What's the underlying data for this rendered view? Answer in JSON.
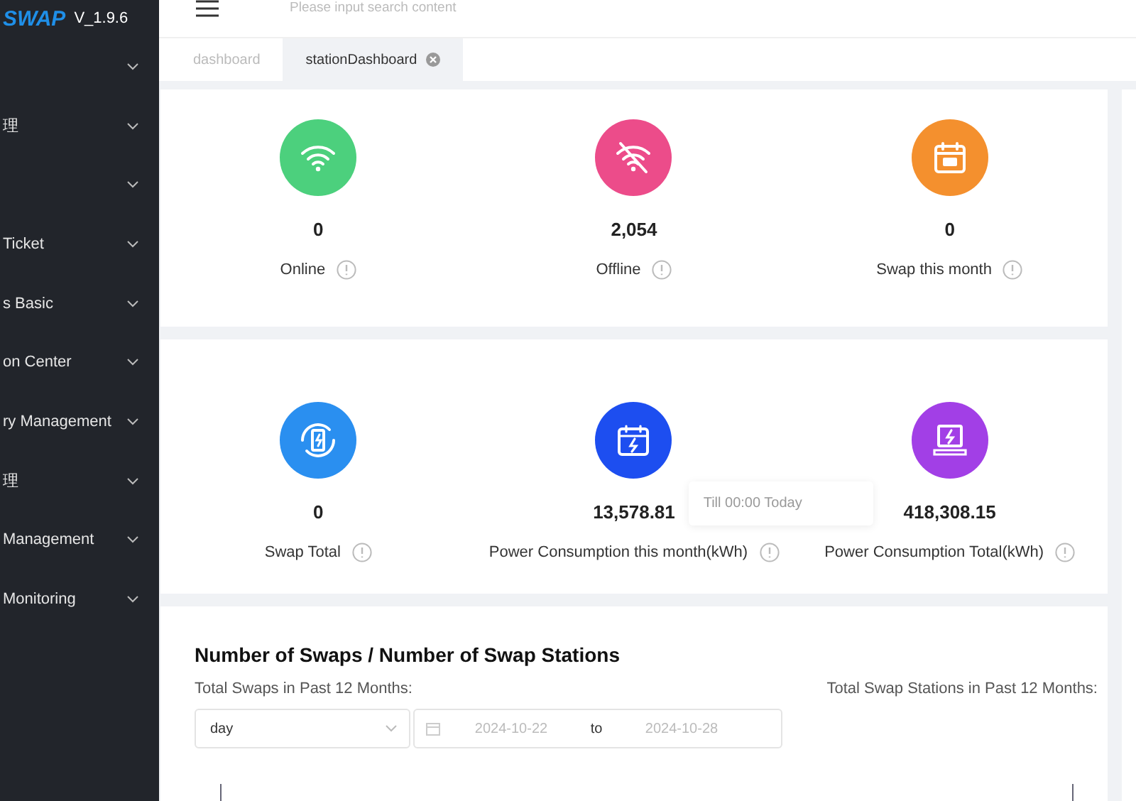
{
  "sidebar": {
    "logo": "SWAP",
    "version": "V_1.9.6",
    "items": [
      {
        "expanded": false
      },
      {
        "label": "理",
        "expanded": false
      },
      {
        "expanded": false
      },
      {
        "label": "Ticket",
        "expanded": false
      },
      {
        "label": "s Basic",
        "expanded": false
      },
      {
        "label": "on Center",
        "expanded": false
      },
      {
        "label": "ry Management",
        "expanded": false
      },
      {
        "label": "理",
        "expanded": false
      },
      {
        "label": "Management",
        "expanded": false
      },
      {
        "label": "Monitoring",
        "expanded": false
      }
    ]
  },
  "header": {
    "search": {
      "placeholder": "Please input search content"
    }
  },
  "tabs": [
    {
      "label": "dashboard",
      "selected": false,
      "closable": false
    },
    {
      "label": "stationDashboard",
      "selected": true,
      "closable": true
    }
  ],
  "stat_cards": [
    {
      "stats": [
        {
          "kind": "wifi",
          "value": "0",
          "label": "Online",
          "color": "#4cd07d"
        },
        {
          "kind": "wifi-off",
          "value": "2,054",
          "label": "Offline",
          "color": "#ec4c8a"
        },
        {
          "kind": "calendar",
          "value": "0",
          "label": "Swap this month",
          "color": "#f4902e"
        }
      ]
    },
    {
      "stats": [
        {
          "kind": "battery",
          "value": "0",
          "label": "Swap Total",
          "color": "#2a8ff0"
        },
        {
          "kind": "calendar-bolt",
          "value": "13,578.81",
          "label": "Power Consumption this month(kWh)",
          "color": "#1d4ef0",
          "tooltip": "Till 00:00 Today"
        },
        {
          "kind": "laptop",
          "value": "418,308.15",
          "label": "Power Consumption Total(kWh)",
          "color": "#a23fe6"
        }
      ]
    }
  ],
  "chart_panel": {
    "title": "Number of Swaps / Number of Swap Stations",
    "left_label": "Total Swaps in Past 12 Months:",
    "right_label": "Total Swap Stations in Past 12 Months:",
    "period": "day",
    "start_date": "2024-10-22",
    "separator": "to",
    "end_date": "2024-10-28"
  }
}
